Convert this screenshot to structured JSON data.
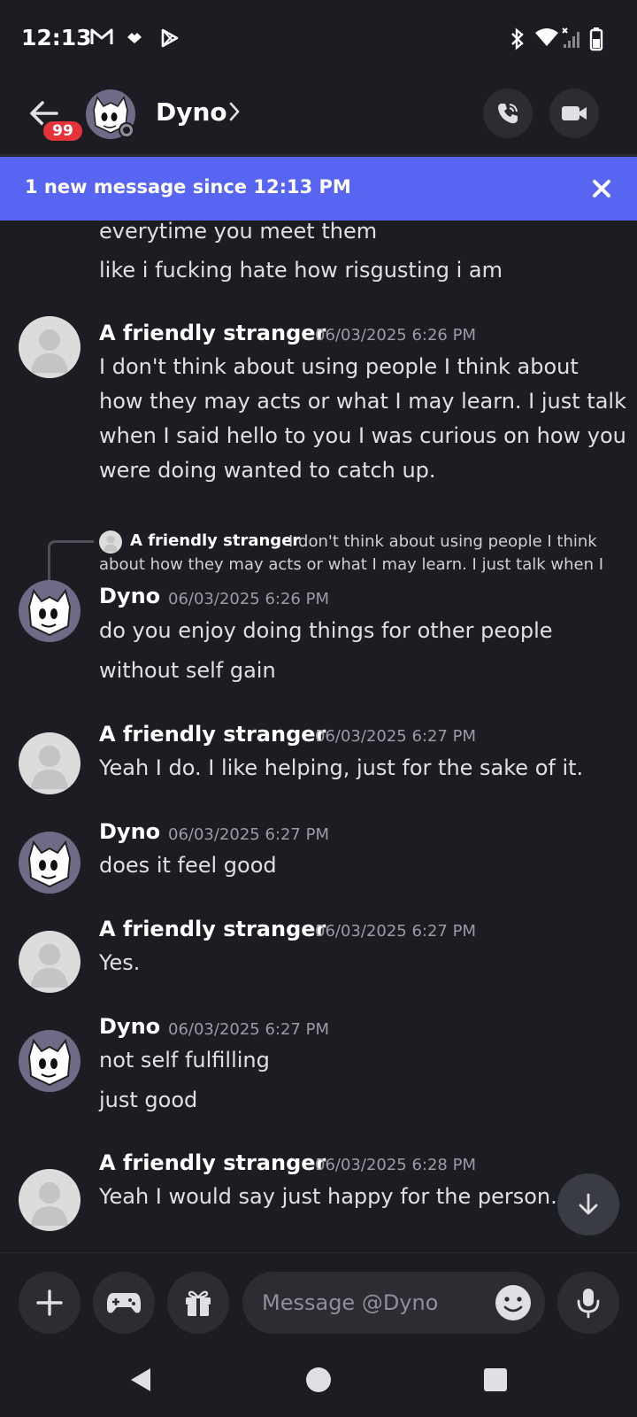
{
  "status_bar": {
    "time": "12:13"
  },
  "header": {
    "badge_count": "99",
    "contact_name": "Dyno"
  },
  "banner": {
    "text": "1 new message since 12:13 PM"
  },
  "messages": {
    "cont_lines": [
      "everytime you meet them",
      "like i fucking hate how risgusting i am"
    ],
    "m1": {
      "author": "A friendly stranger",
      "timestamp": "06/03/2025 6:26 PM",
      "lines": [
        "I don't think about using people I think about",
        "how they may acts or what I may learn. I just talk",
        "when I said hello to you I was curious on how you",
        "were doing wanted to catch up."
      ]
    },
    "reply": {
      "author": "A friendly stranger",
      "line1": "I don't think about using people I think",
      "line2": "about how they may acts or what I may learn. I just talk when I"
    },
    "m2": {
      "author": "Dyno",
      "timestamp": "06/03/2025 6:26 PM",
      "lines": [
        "do you enjoy doing things for other people",
        "without self gain"
      ]
    },
    "m3": {
      "author": "A friendly stranger",
      "timestamp": "06/03/2025 6:27 PM",
      "lines": [
        "Yeah I do. I like helping, just for the sake of it."
      ]
    },
    "m4": {
      "author": "Dyno",
      "timestamp": "06/03/2025 6:27 PM",
      "lines": [
        "does it feel good"
      ]
    },
    "m5": {
      "author": "A friendly stranger",
      "timestamp": "06/03/2025 6:27 PM",
      "lines": [
        "Yes."
      ]
    },
    "m6": {
      "author": "Dyno",
      "timestamp": "06/03/2025 6:27 PM",
      "lines": [
        "not self fulfilling",
        "just good"
      ]
    },
    "m7": {
      "author": "A friendly stranger",
      "timestamp": "06/03/2025 6:28 PM",
      "lines": [
        "Yeah I would say just happy for the person."
      ]
    }
  },
  "composer": {
    "placeholder": "Message @Dyno"
  },
  "icons": {
    "status": [
      "gmail-icon",
      "diamond-app-icon",
      "play-store-icon",
      "bluetooth-icon",
      "wifi-icon",
      "signal-icon",
      "battery-icon"
    ],
    "header": [
      "back-arrow-icon",
      "chevron-right-icon",
      "phone-icon",
      "video-camera-icon"
    ],
    "composer": [
      "plus-icon",
      "gamepad-icon",
      "gift-icon",
      "emoji-icon",
      "microphone-icon"
    ],
    "nav": [
      "nav-back-icon",
      "nav-home-icon",
      "nav-recents-icon"
    ]
  },
  "colors": {
    "accent": "#5865f2",
    "background": "#1c1d22",
    "badge": "#e5333a"
  }
}
